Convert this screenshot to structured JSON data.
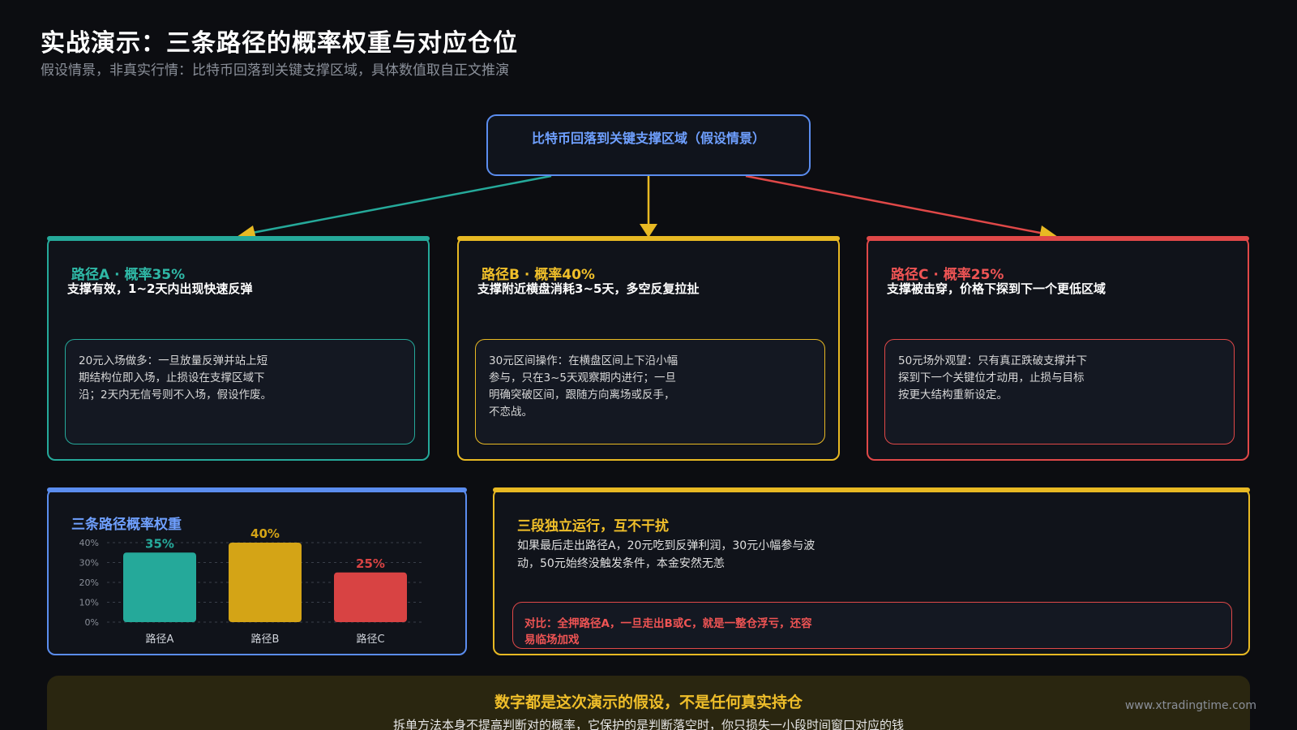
{
  "header": {
    "title": "实战演示：三条路径的概率权重与对应仓位",
    "subtitle": "假设情景，非真实行情：比特币回落到关键支撑区域，具体数值取自正文推演"
  },
  "root": {
    "label": "比特币回落到关键支撑区域（假设情景）"
  },
  "paths": [
    {
      "title": "路径A · 概率35%",
      "desc": "支撑有效，1~2天内出现快速反弹",
      "action": "20元入场做多：一旦放量反弹并站上短期结构位即入场，止损设在支撑区域下沿；2天内无信号则不入场，假设作废。",
      "color": "#25a99a"
    },
    {
      "title": "路径B · 概率40%",
      "desc": "支撑附近横盘消耗3~5天，多空反复拉扯",
      "action": "30元区间操作：在横盘区间上下沿小幅参与，只在3~5天观察期内进行；一旦明确突破区间，跟随方向离场或反手，不恋战。",
      "color": "#e8b923"
    },
    {
      "title": "路径C · 概率25%",
      "desc": "支撑被击穿，价格下探到下一个更低区域",
      "action": "50元场外观望：只有真正跌破支撑并下探到下一个关键位才动用，止损与目标按更大结构重新设定。",
      "color": "#e04848"
    }
  ],
  "chart_data": {
    "type": "bar",
    "title": "三条路径概率权重",
    "categories": [
      "路径A",
      "路径B",
      "路径C"
    ],
    "values": [
      35,
      40,
      25
    ],
    "value_labels": [
      "35%",
      "40%",
      "25%"
    ],
    "colors": [
      "#25a99a",
      "#d4a416",
      "#d84343"
    ],
    "yticks": [
      "0%",
      "10%",
      "20%",
      "30%",
      "40%"
    ],
    "ylim": [
      0,
      40
    ],
    "grid": true
  },
  "note": {
    "title": "三段独立运行，互不干扰",
    "body": "如果最后走出路径A，20元吃到反弹利润，30元小幅参与波动，50元始终没触发条件，本金安然无恙",
    "compare": "对比：全押路径A，一旦走出B或C，就是一整仓浮亏，还容易临场加戏"
  },
  "footer": {
    "title": "数字都是这次演示的假设，不是任何真实持仓",
    "body": "拆单方法本身不提高判断对的概率，它保护的是判断落空时，你只损失一小段时间窗口对应的钱"
  },
  "watermark": "www.xtradingtime.com"
}
